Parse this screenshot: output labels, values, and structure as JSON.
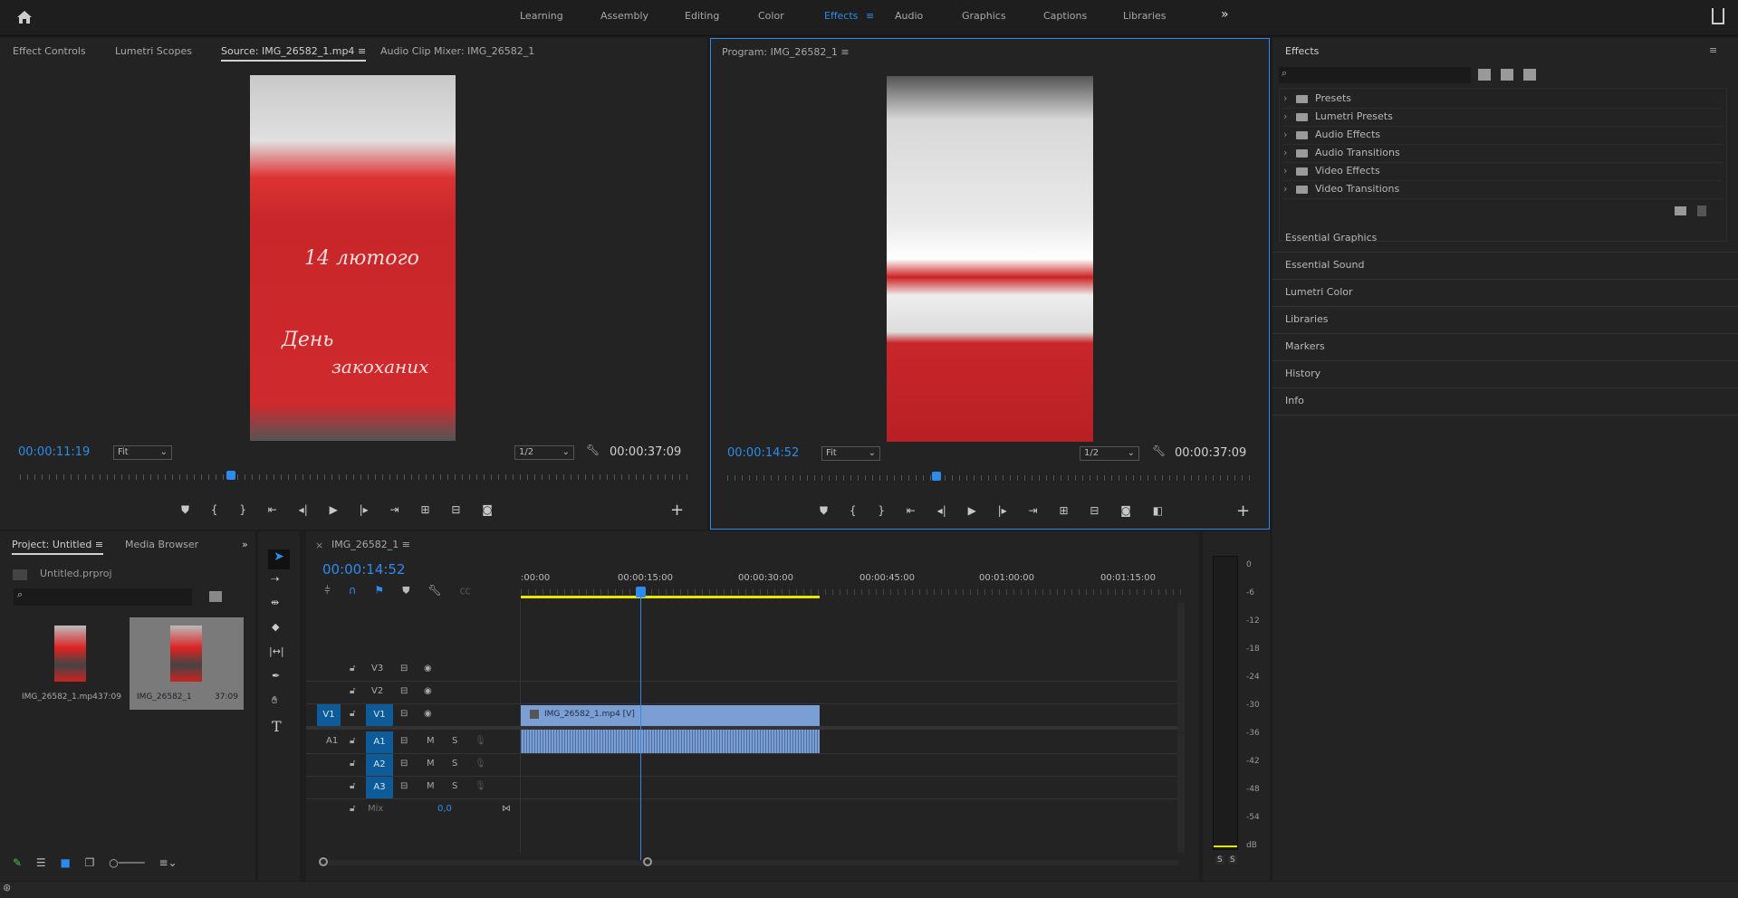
{
  "workspaces": {
    "items": [
      "Learning",
      "Assembly",
      "Editing",
      "Color",
      "Effects",
      "Audio",
      "Graphics",
      "Captions",
      "Libraries"
    ],
    "active": "Effects",
    "more": "»"
  },
  "source_panel": {
    "tabs": [
      "Effect Controls",
      "Lumetri Scopes",
      "Source: IMG_26582_1.mp4",
      "Audio Clip Mixer: IMG_26582_1"
    ],
    "selected_tab": "Source: IMG_26582_1.mp4",
    "timecode": "00:00:11:19",
    "fit": "Fit",
    "resolution": "1/2",
    "duration": "00:00:37:09",
    "playhead_fraction": 0.316,
    "frame_text": [
      "14 лютого",
      "День",
      "закоханих"
    ]
  },
  "program_panel": {
    "title": "Program: IMG_26582_1",
    "timecode": "00:00:14:52",
    "fit": "Fit",
    "resolution": "1/2",
    "duration": "00:00:37:09",
    "playhead_fraction": 0.4
  },
  "effects_panel": {
    "title": "Effects",
    "search_placeholder": "",
    "tree": [
      "Presets",
      "Lumetri Presets",
      "Audio Effects",
      "Audio Transitions",
      "Video Effects",
      "Video Transitions"
    ],
    "collapsed_panels": [
      "Essential Graphics",
      "Essential Sound",
      "Lumetri Color",
      "Libraries",
      "Markers",
      "History",
      "Info"
    ]
  },
  "project_panel": {
    "tabs": [
      "Project: Untitled",
      "Media Browser"
    ],
    "file": "Untitled.prproj",
    "items": [
      {
        "name": "IMG_26582_1.mp4",
        "duration": "37:09"
      },
      {
        "name": "IMG_26582_1",
        "duration": "37:09",
        "selected": true
      }
    ]
  },
  "timeline": {
    "tab": "IMG_26582_1",
    "timecode": "00:00:14:52",
    "ruler": [
      ":00:00",
      "00:00:15:00",
      "00:00:30:00",
      "00:00:45:00",
      "00:01:00:00",
      "00:01:15:00"
    ],
    "video_tracks": [
      "V3",
      "V2",
      "V1"
    ],
    "audio_tracks": [
      "A1",
      "A2",
      "A3"
    ],
    "source_v": "V1",
    "source_a": "A1",
    "mix_label": "Mix",
    "mix_value": "0,0",
    "clip_video": "IMG_26582_1.mp4 [V]",
    "mute": "M",
    "solo": "S"
  },
  "meter": {
    "labels": [
      "0",
      "-6",
      "-12",
      "-18",
      "-24",
      "-30",
      "-36",
      "-42",
      "-48",
      "-54",
      "dB"
    ],
    "solo": [
      "S",
      "S"
    ]
  },
  "colors": {
    "accent": "#2d8ceb",
    "clip": "#7b9fd4",
    "track_target": "#0e5b99",
    "work_area": "#e6e600"
  }
}
